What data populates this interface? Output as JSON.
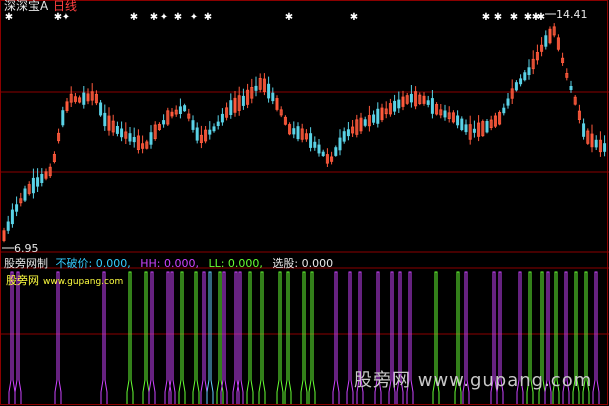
{
  "header": {
    "stock_name": "深深宝A",
    "period": "日线"
  },
  "price_axis": {
    "high_label": "14.41",
    "low_label": "6.95"
  },
  "indicator": {
    "name": "股旁网制",
    "buy_point_label": "不破价: 0.000,",
    "hh_label": "HH: 0.000,",
    "ll_label": "LL: 0.000,",
    "select_label": "选股: 0.000"
  },
  "branding": {
    "small_logo": "股旁网",
    "small_url": "www.gupang.com",
    "watermark": "股旁网 www.gupang.com"
  },
  "colors": {
    "background": "#000000",
    "grid_red": "#8b0000",
    "candle_up": "#ff5a3c",
    "candle_down": "#5ad2e6",
    "indicator_magenta": "#cc44ff",
    "indicator_green": "#66ff33",
    "star_white": "#ffffff"
  },
  "signals": {
    "marker_icon": "white-star-icon",
    "markers": 17
  }
}
